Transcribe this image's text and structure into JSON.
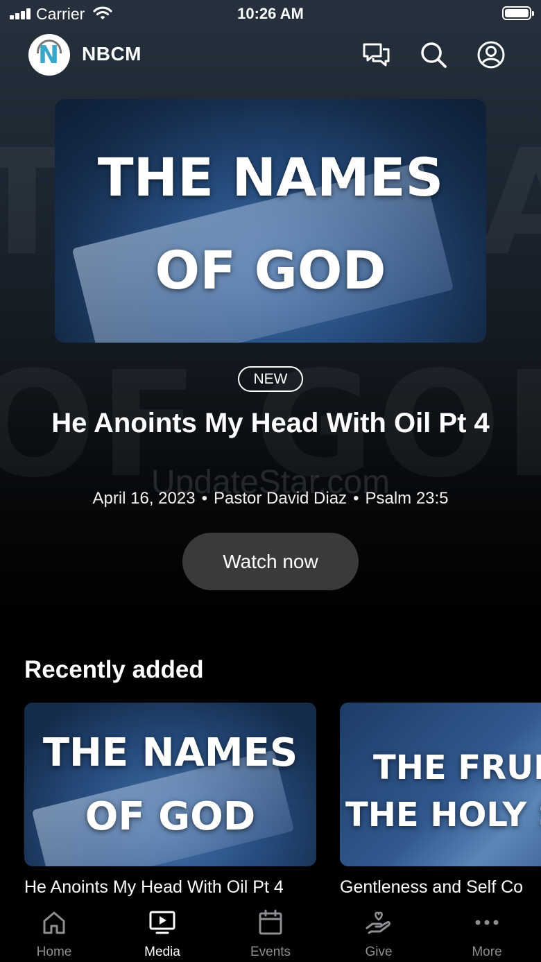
{
  "status_bar": {
    "carrier": "Carrier",
    "time": "10:26 AM"
  },
  "header": {
    "brand": "NBCM",
    "logo_letter": "N"
  },
  "hero": {
    "art_line1": "THE NAMES",
    "art_line2": "OF GOD",
    "badge": "NEW",
    "title": "He Anoints My Head With Oil Pt 4",
    "date": "April 16, 2023",
    "speaker": "Pastor David Diaz",
    "scripture": "Psalm 23:5",
    "separator": "•",
    "watch_label": "Watch now"
  },
  "watermark": "UpdateStar.com",
  "recent": {
    "heading": "Recently added",
    "items": [
      {
        "art_line1": "THE NAMES",
        "art_line2": "OF GOD",
        "title": "He Anoints My Head With Oil Pt 4"
      },
      {
        "art_line1": "THE FRUIT",
        "art_line2": "THE HOLY S",
        "title": "Gentleness and Self Co"
      }
    ]
  },
  "tabs": [
    {
      "label": "Home",
      "icon": "home-icon",
      "active": false
    },
    {
      "label": "Media",
      "icon": "media-icon",
      "active": true
    },
    {
      "label": "Events",
      "icon": "calendar-icon",
      "active": false
    },
    {
      "label": "Give",
      "icon": "give-icon",
      "active": false
    },
    {
      "label": "More",
      "icon": "more-icon",
      "active": false
    }
  ]
}
